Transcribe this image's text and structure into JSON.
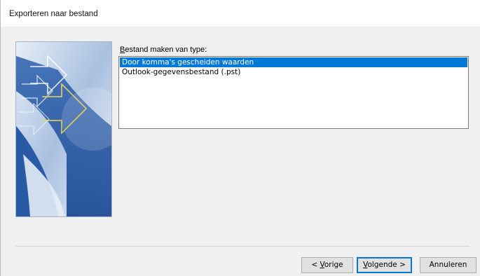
{
  "window": {
    "title": "Exporteren naar bestand"
  },
  "file_type": {
    "label_prefix": "",
    "label_accel": "B",
    "label_rest": "estand maken van type:",
    "items": [
      {
        "label": "Door komma's gescheiden waarden",
        "selected": true
      },
      {
        "label": "Outlook-gegevensbestand (.pst)",
        "selected": false
      }
    ]
  },
  "buttons": {
    "back": {
      "pre": "< ",
      "accel": "V",
      "rest": "orige"
    },
    "next": {
      "pre": "",
      "accel": "V",
      "rest": "olgende >"
    },
    "cancel": {
      "label": "Annuleren"
    }
  },
  "colors": {
    "selection": "#0078d7",
    "default_button_border": "#0078d7"
  }
}
